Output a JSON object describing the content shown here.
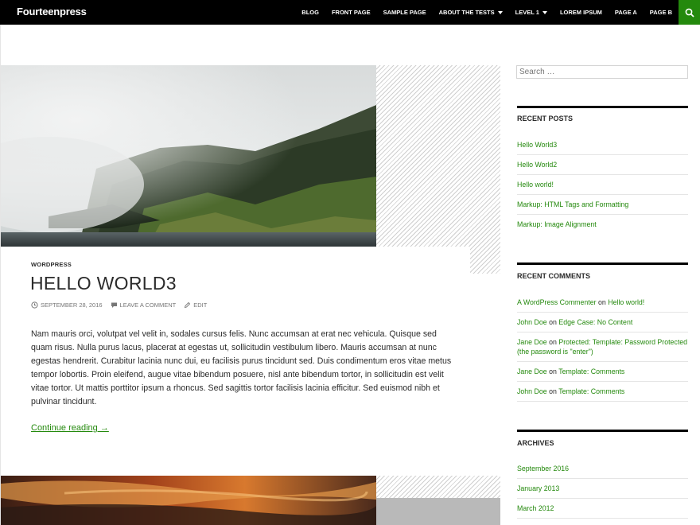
{
  "site": {
    "title": "Fourteenpress"
  },
  "nav": {
    "items": [
      {
        "label": "BLOG",
        "has_dropdown": false
      },
      {
        "label": "FRONT PAGE",
        "has_dropdown": false
      },
      {
        "label": "SAMPLE PAGE",
        "has_dropdown": false
      },
      {
        "label": "ABOUT THE TESTS",
        "has_dropdown": true
      },
      {
        "label": "LEVEL 1",
        "has_dropdown": true
      },
      {
        "label": "LOREM IPSUM",
        "has_dropdown": false
      },
      {
        "label": "PAGE A",
        "has_dropdown": false
      },
      {
        "label": "PAGE B",
        "has_dropdown": false
      }
    ],
    "search_icon": "search-icon"
  },
  "post": {
    "category": "WORDPRESS",
    "title": "HELLO WORLD3",
    "date": "SEPTEMBER 28, 2016",
    "comment_link": "LEAVE A COMMENT",
    "edit_link": "EDIT",
    "body": "Nam mauris orci, volutpat vel velit in, sodales cursus felis. Nunc accumsan at erat nec vehicula. Quisque sed quam risus. Nulla purus lacus, placerat at egestas ut, sollicitudin vestibulum libero. Mauris accumsan at nunc egestas hendrerit. Curabitur lacinia nunc dui, eu facilisis purus tincidunt sed. Duis condimentum eros vitae metus tempor lobortis. Proin eleifend, augue vitae bibendum posuere, nisl ante bibendum tortor, in sollicitudin est velit vitae tortor. Ut mattis porttitor ipsum a rhoncus. Sed sagittis tortor facilisis lacinia efficitur. Sed euismod nibh et pulvinar tincidunt.",
    "more_link": "Continue reading →"
  },
  "sidebar": {
    "search_placeholder": "Search …",
    "recent_posts": {
      "title": "RECENT POSTS",
      "items": [
        "Hello World3",
        "Hello World2",
        "Hello world!",
        "Markup: HTML Tags and Formatting",
        "Markup: Image Alignment"
      ]
    },
    "recent_comments": {
      "title": "RECENT COMMENTS",
      "items": [
        {
          "author": "A WordPress Commenter",
          "on": "on",
          "post": "Hello world!"
        },
        {
          "author": "John Doe",
          "on": "on",
          "post": "Edge Case: No Content"
        },
        {
          "author": "Jane Doe",
          "on": "on",
          "post": "Protected: Template: Password Protected (the password is \"enter\")"
        },
        {
          "author": "Jane Doe",
          "on": "on",
          "post": "Template: Comments"
        },
        {
          "author": "John Doe",
          "on": "on",
          "post": "Template: Comments"
        }
      ]
    },
    "archives": {
      "title": "ARCHIVES",
      "items": [
        "September 2016",
        "January 2013",
        "March 2012"
      ]
    }
  },
  "colors": {
    "accent": "#24890d",
    "header_bg": "#000000",
    "text": "#2b2b2b",
    "meta": "#767676"
  }
}
